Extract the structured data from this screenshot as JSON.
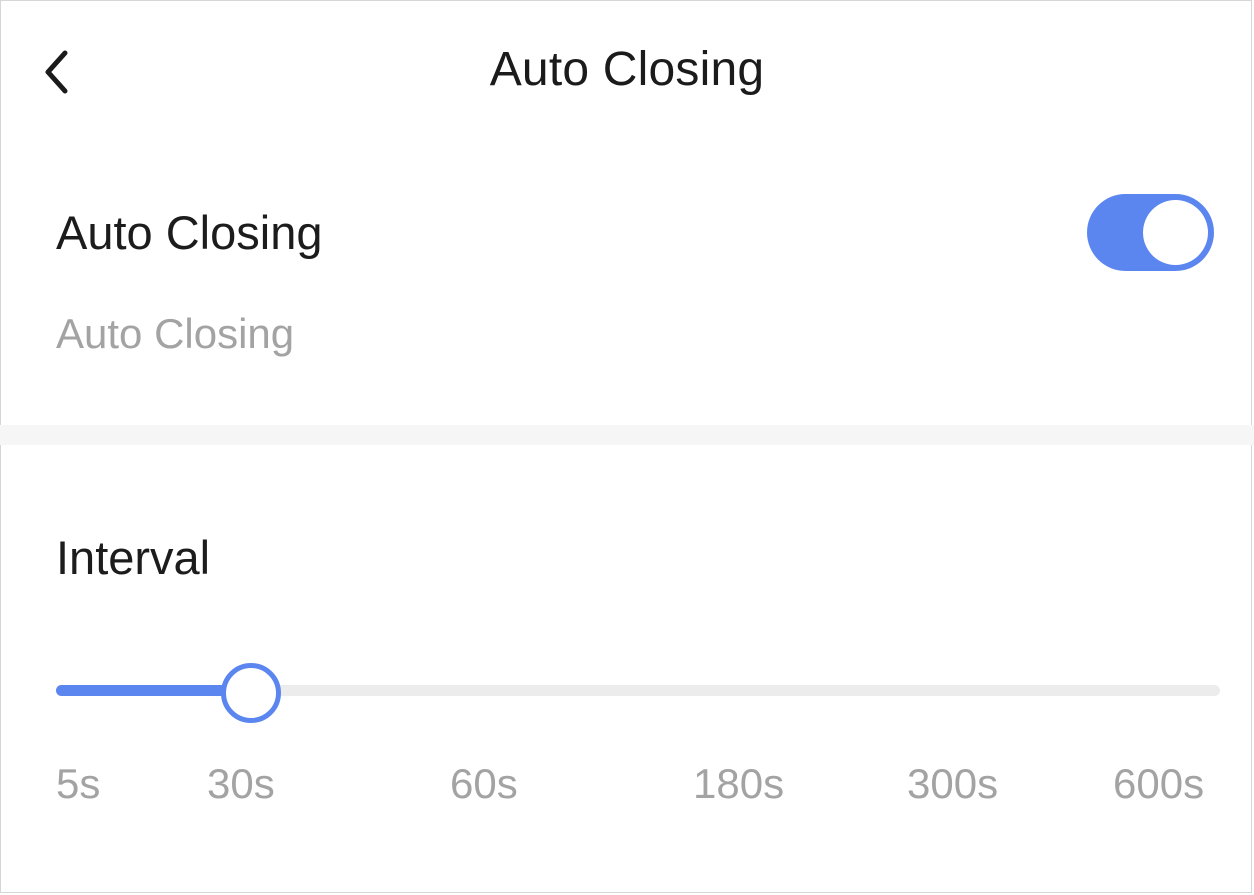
{
  "header": {
    "title": "Auto Closing",
    "back_icon": "chevron-left-icon"
  },
  "auto_closing": {
    "title": "Auto Closing",
    "description": "Auto Closing",
    "enabled": true,
    "toggle_color": "#5b86ef"
  },
  "interval": {
    "title": "Interval",
    "selected": "30s",
    "ticks": [
      "5s",
      "30s",
      "60s",
      "180s",
      "300s",
      "600s"
    ],
    "accent_color": "#5b86ef"
  }
}
